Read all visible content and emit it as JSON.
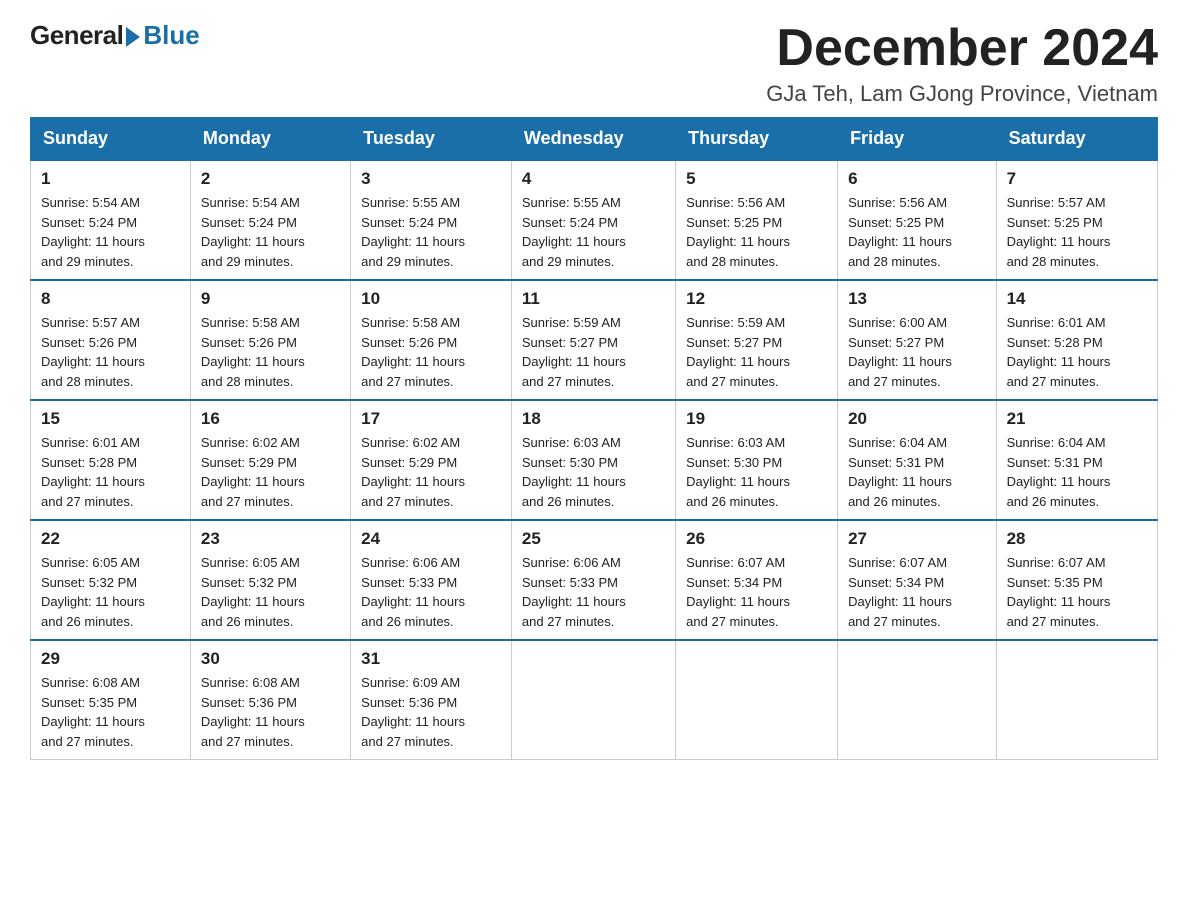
{
  "logo": {
    "general": "General",
    "blue": "Blue"
  },
  "header": {
    "month": "December 2024",
    "location": "GJa Teh, Lam GJong Province, Vietnam"
  },
  "weekdays": [
    "Sunday",
    "Monday",
    "Tuesday",
    "Wednesday",
    "Thursday",
    "Friday",
    "Saturday"
  ],
  "weeks": [
    [
      {
        "day": "1",
        "sunrise": "5:54 AM",
        "sunset": "5:24 PM",
        "daylight": "11 hours and 29 minutes."
      },
      {
        "day": "2",
        "sunrise": "5:54 AM",
        "sunset": "5:24 PM",
        "daylight": "11 hours and 29 minutes."
      },
      {
        "day": "3",
        "sunrise": "5:55 AM",
        "sunset": "5:24 PM",
        "daylight": "11 hours and 29 minutes."
      },
      {
        "day": "4",
        "sunrise": "5:55 AM",
        "sunset": "5:24 PM",
        "daylight": "11 hours and 29 minutes."
      },
      {
        "day": "5",
        "sunrise": "5:56 AM",
        "sunset": "5:25 PM",
        "daylight": "11 hours and 28 minutes."
      },
      {
        "day": "6",
        "sunrise": "5:56 AM",
        "sunset": "5:25 PM",
        "daylight": "11 hours and 28 minutes."
      },
      {
        "day": "7",
        "sunrise": "5:57 AM",
        "sunset": "5:25 PM",
        "daylight": "11 hours and 28 minutes."
      }
    ],
    [
      {
        "day": "8",
        "sunrise": "5:57 AM",
        "sunset": "5:26 PM",
        "daylight": "11 hours and 28 minutes."
      },
      {
        "day": "9",
        "sunrise": "5:58 AM",
        "sunset": "5:26 PM",
        "daylight": "11 hours and 28 minutes."
      },
      {
        "day": "10",
        "sunrise": "5:58 AM",
        "sunset": "5:26 PM",
        "daylight": "11 hours and 27 minutes."
      },
      {
        "day": "11",
        "sunrise": "5:59 AM",
        "sunset": "5:27 PM",
        "daylight": "11 hours and 27 minutes."
      },
      {
        "day": "12",
        "sunrise": "5:59 AM",
        "sunset": "5:27 PM",
        "daylight": "11 hours and 27 minutes."
      },
      {
        "day": "13",
        "sunrise": "6:00 AM",
        "sunset": "5:27 PM",
        "daylight": "11 hours and 27 minutes."
      },
      {
        "day": "14",
        "sunrise": "6:01 AM",
        "sunset": "5:28 PM",
        "daylight": "11 hours and 27 minutes."
      }
    ],
    [
      {
        "day": "15",
        "sunrise": "6:01 AM",
        "sunset": "5:28 PM",
        "daylight": "11 hours and 27 minutes."
      },
      {
        "day": "16",
        "sunrise": "6:02 AM",
        "sunset": "5:29 PM",
        "daylight": "11 hours and 27 minutes."
      },
      {
        "day": "17",
        "sunrise": "6:02 AM",
        "sunset": "5:29 PM",
        "daylight": "11 hours and 27 minutes."
      },
      {
        "day": "18",
        "sunrise": "6:03 AM",
        "sunset": "5:30 PM",
        "daylight": "11 hours and 26 minutes."
      },
      {
        "day": "19",
        "sunrise": "6:03 AM",
        "sunset": "5:30 PM",
        "daylight": "11 hours and 26 minutes."
      },
      {
        "day": "20",
        "sunrise": "6:04 AM",
        "sunset": "5:31 PM",
        "daylight": "11 hours and 26 minutes."
      },
      {
        "day": "21",
        "sunrise": "6:04 AM",
        "sunset": "5:31 PM",
        "daylight": "11 hours and 26 minutes."
      }
    ],
    [
      {
        "day": "22",
        "sunrise": "6:05 AM",
        "sunset": "5:32 PM",
        "daylight": "11 hours and 26 minutes."
      },
      {
        "day": "23",
        "sunrise": "6:05 AM",
        "sunset": "5:32 PM",
        "daylight": "11 hours and 26 minutes."
      },
      {
        "day": "24",
        "sunrise": "6:06 AM",
        "sunset": "5:33 PM",
        "daylight": "11 hours and 26 minutes."
      },
      {
        "day": "25",
        "sunrise": "6:06 AM",
        "sunset": "5:33 PM",
        "daylight": "11 hours and 27 minutes."
      },
      {
        "day": "26",
        "sunrise": "6:07 AM",
        "sunset": "5:34 PM",
        "daylight": "11 hours and 27 minutes."
      },
      {
        "day": "27",
        "sunrise": "6:07 AM",
        "sunset": "5:34 PM",
        "daylight": "11 hours and 27 minutes."
      },
      {
        "day": "28",
        "sunrise": "6:07 AM",
        "sunset": "5:35 PM",
        "daylight": "11 hours and 27 minutes."
      }
    ],
    [
      {
        "day": "29",
        "sunrise": "6:08 AM",
        "sunset": "5:35 PM",
        "daylight": "11 hours and 27 minutes."
      },
      {
        "day": "30",
        "sunrise": "6:08 AM",
        "sunset": "5:36 PM",
        "daylight": "11 hours and 27 minutes."
      },
      {
        "day": "31",
        "sunrise": "6:09 AM",
        "sunset": "5:36 PM",
        "daylight": "11 hours and 27 minutes."
      },
      null,
      null,
      null,
      null
    ]
  ],
  "labels": {
    "sunrise": "Sunrise:",
    "sunset": "Sunset:",
    "daylight": "Daylight:"
  }
}
